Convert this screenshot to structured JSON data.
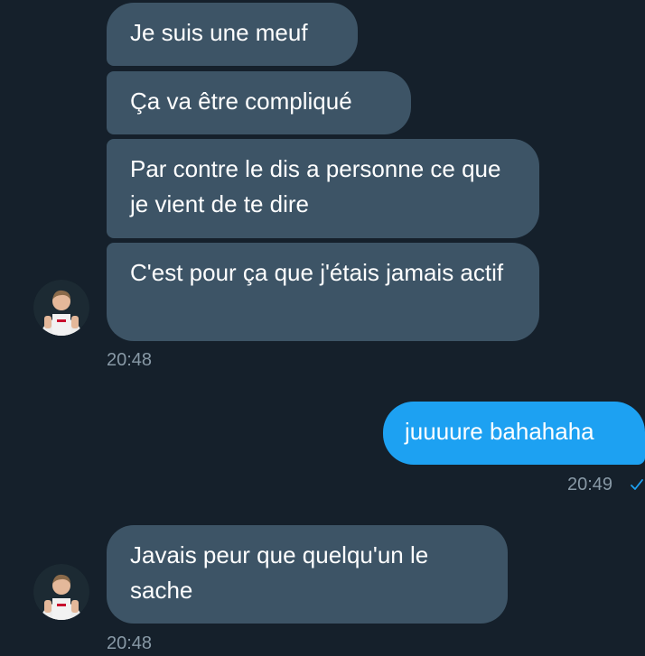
{
  "messages": [
    {
      "text": "Je suis une meuf"
    },
    {
      "text": "Ça va être compliqué"
    },
    {
      "text": "Par contre le dis a personne ce que je vient de te dire"
    },
    {
      "text": "C'est pour ça que j'étais jamais actif"
    },
    {
      "timestamp": "20:48"
    },
    {
      "text": "juuuure bahahaha"
    },
    {
      "timestamp": "20:49"
    },
    {
      "text": "Javais peur que quelqu'un le sache"
    },
    {
      "timestamp": "20:48"
    }
  ],
  "colors": {
    "background": "#15202b",
    "incoming_bubble": "#3d5466",
    "outgoing_bubble": "#1da1f2",
    "timestamp": "#8899a6",
    "read_check": "#1da1f2"
  },
  "icons": {
    "read_receipt": "check-icon",
    "avatar": "avatar"
  }
}
